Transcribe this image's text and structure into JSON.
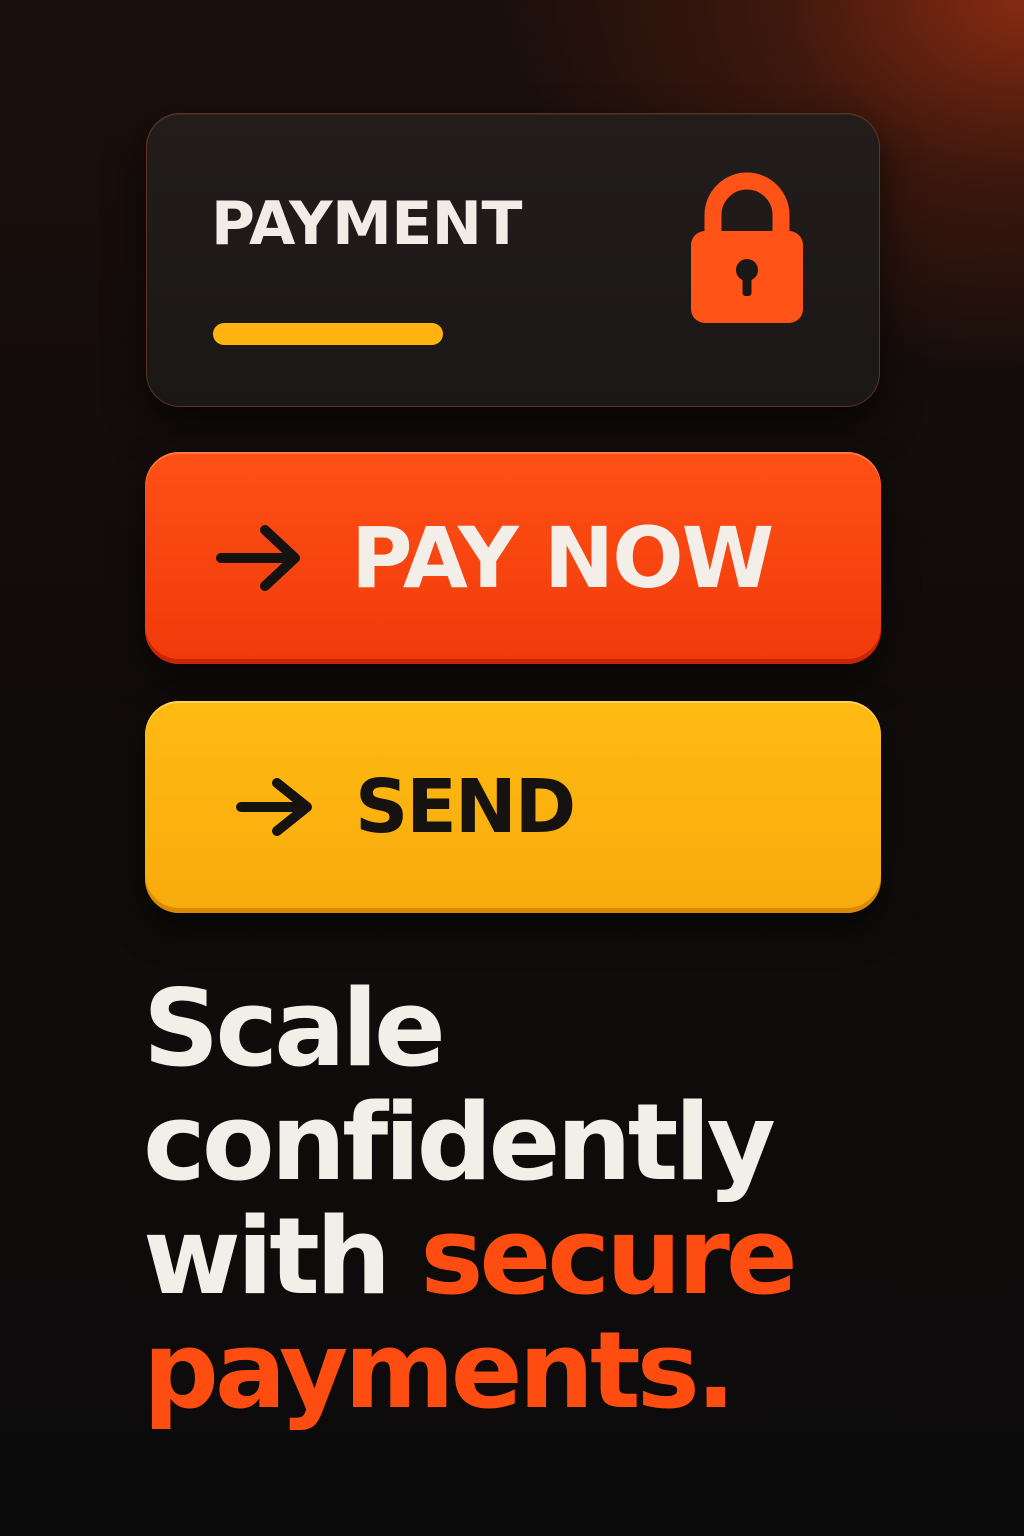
{
  "colors": {
    "accent_orange": "#ff4d12",
    "button_pay_top": "#ff5016",
    "button_pay_bottom": "#f03a0a",
    "button_send_top": "#ffbb12",
    "button_send_bottom": "#f8aa0d",
    "card_bar": "#ffb30f",
    "lock": "#ff5317",
    "text_light": "#f2eee8",
    "text_dark": "#161210"
  },
  "payment_card": {
    "title": "PAYMENT",
    "icon": "lock-icon"
  },
  "buttons": {
    "pay_now": {
      "label": "PAY NOW",
      "icon": "arrow-right-icon"
    },
    "send": {
      "label": "SEND",
      "icon": "arrow-right-icon"
    }
  },
  "headline": {
    "line1": "Scale",
    "line2": "confidently",
    "line3_plain": "with",
    "line3_accent": "secure",
    "line4_accent": "payments."
  }
}
